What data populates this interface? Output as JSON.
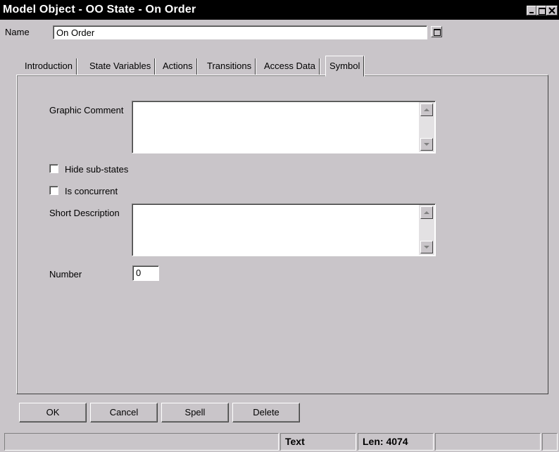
{
  "window": {
    "title": "Model Object - OO State - On Order"
  },
  "name_field": {
    "label": "Name",
    "value": "On Order"
  },
  "tabs": [
    {
      "label": "Introduction",
      "active": false
    },
    {
      "label": "State Variables",
      "active": false
    },
    {
      "label": "Actions",
      "active": false
    },
    {
      "label": "Transitions",
      "active": false
    },
    {
      "label": "Access Data",
      "active": false
    },
    {
      "label": "Symbol",
      "active": true
    }
  ],
  "symbol_tab": {
    "graphic_comment_label": "Graphic Comment",
    "graphic_comment_value": "",
    "hide_substates_label": "Hide sub-states",
    "hide_substates_checked": false,
    "is_concurrent_label": "Is concurrent",
    "is_concurrent_checked": false,
    "short_description_label": "Short Description",
    "short_description_value": "",
    "number_label": "Number",
    "number_value": "0"
  },
  "buttons": {
    "ok": "OK",
    "cancel": "Cancel",
    "spell": "Spell",
    "delete": "Delete"
  },
  "statusbar": {
    "mode": "Text",
    "length": "Len: 4074"
  },
  "colors": {
    "window_bg": "#c9c5c9",
    "titlebar_bg": "#000000",
    "titlebar_text": "#ffffff"
  }
}
